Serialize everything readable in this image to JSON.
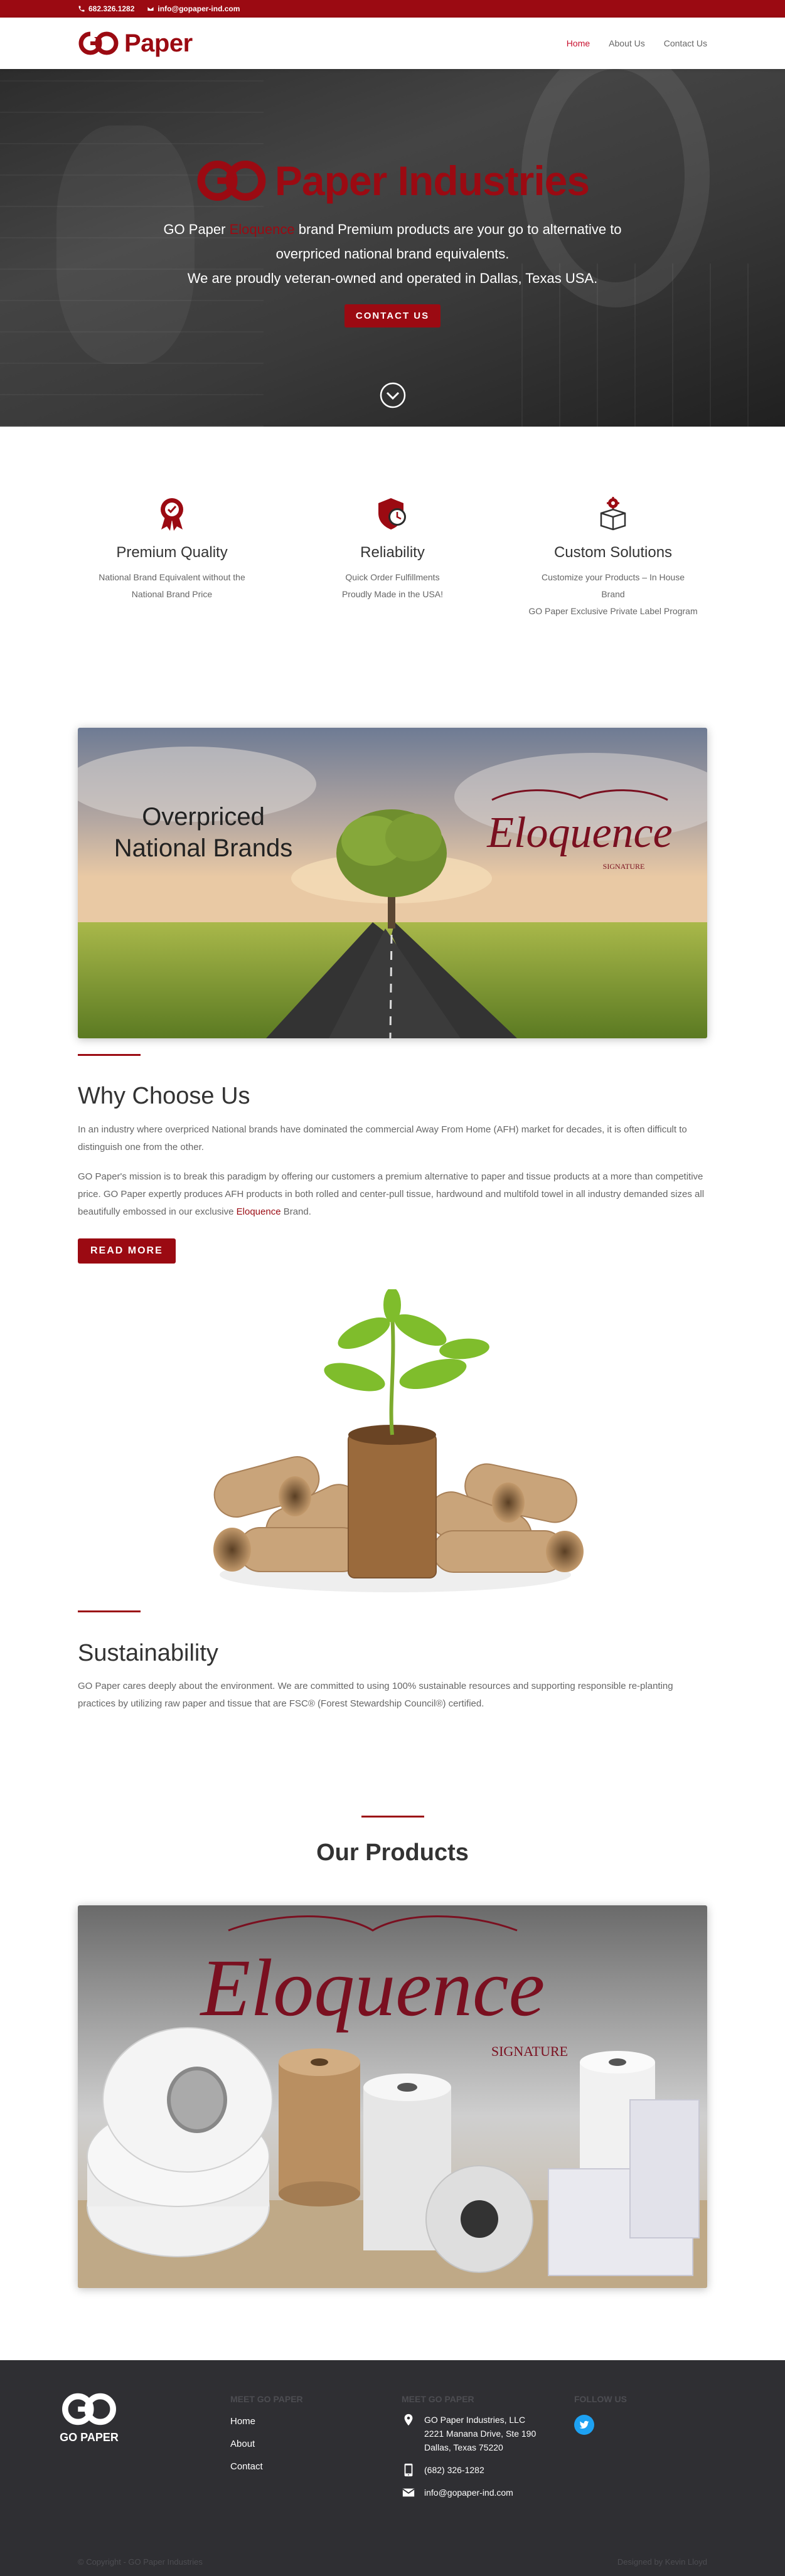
{
  "topbar": {
    "phone": "682.326.1282",
    "email": "info@gopaper-ind.com"
  },
  "header": {
    "logo_mark": "GO",
    "logo_text": "Paper",
    "nav": [
      {
        "label": "Home",
        "active": true
      },
      {
        "label": "About Us",
        "active": false
      },
      {
        "label": "Contact Us",
        "active": false
      }
    ]
  },
  "hero": {
    "brand_text": "Paper Industries",
    "line1_pre": "GO Paper",
    "line1_brand": "Eloquence",
    "line1_post": "brand Premium products are your go to alternative to",
    "line2": "overpriced national brand equivalents.",
    "line3": "We are proudly veteran-owned and operated in Dallas, Texas USA.",
    "button": "CONTACT US"
  },
  "features": [
    {
      "icon": "award-ribbon-icon",
      "title": "Premium Quality",
      "lines": [
        "National Brand Equivalent without the",
        "National Brand Price"
      ]
    },
    {
      "icon": "shield-clock-icon",
      "title": "Reliability",
      "lines": [
        "Quick Order Fulfillments",
        "Proudly Made in the USA!"
      ]
    },
    {
      "icon": "gear-box-icon",
      "title": "Custom Solutions",
      "lines": [
        "Customize your Products – In House",
        "Brand",
        "GO Paper Exclusive Private Label Program"
      ]
    }
  ],
  "banner": {
    "left_line1": "Overpriced",
    "left_line2": "National Brands",
    "right_brand": "Eloquence",
    "right_sub": "SIGNATURE"
  },
  "why": {
    "title": "Why Choose Us",
    "p1": "In an industry where overpriced National brands have dominated the commercial Away From Home (AFH) market for decades, it is often difficult to distinguish one from the other.",
    "p2_pre": "GO Paper's mission is to break this paradigm by offering our customers a premium alternative to paper and tissue products at a more than competitive price. GO Paper expertly produces AFH products in both rolled and center-pull tissue, hardwound and multifold towel in all industry demanded sizes all beautifully embossed in our exclusive",
    "p2_link": "Eloquence",
    "p2_post": "Brand.",
    "button": "READ MORE"
  },
  "sustainability": {
    "title": "Sustainability",
    "text": "GO Paper cares deeply about the environment. We are committed to using 100% sustainable resources and supporting responsible re-planting practices by utilizing raw paper and tissue that are FSC® (Forest Stewardship Council®) certified."
  },
  "products": {
    "title": "Our Products",
    "brand": "Eloquence",
    "sub": "SIGNATURE"
  },
  "footer": {
    "logo_text": "GO PAPER",
    "col1_title": "MEET GO PAPER",
    "links": [
      "Home",
      "About",
      "Contact"
    ],
    "col2_title": "MEET GO PAPER",
    "address": [
      "GO Paper Industries, LLC",
      "2221 Manana Drive, Ste 190",
      "Dallas, Texas 75220"
    ],
    "phone": "(682) 326-1282",
    "email": "info@gopaper-ind.com",
    "col3_title": "FOLLOW US",
    "copyright": "© Copyright - GO Paper Industries",
    "designed": "Designed by Kevin Lloyd"
  },
  "colors": {
    "brand_red": "#9b0a12",
    "nav_active": "#c8102e",
    "footer_bg": "#2f2f33",
    "twitter": "#1da1f2"
  }
}
